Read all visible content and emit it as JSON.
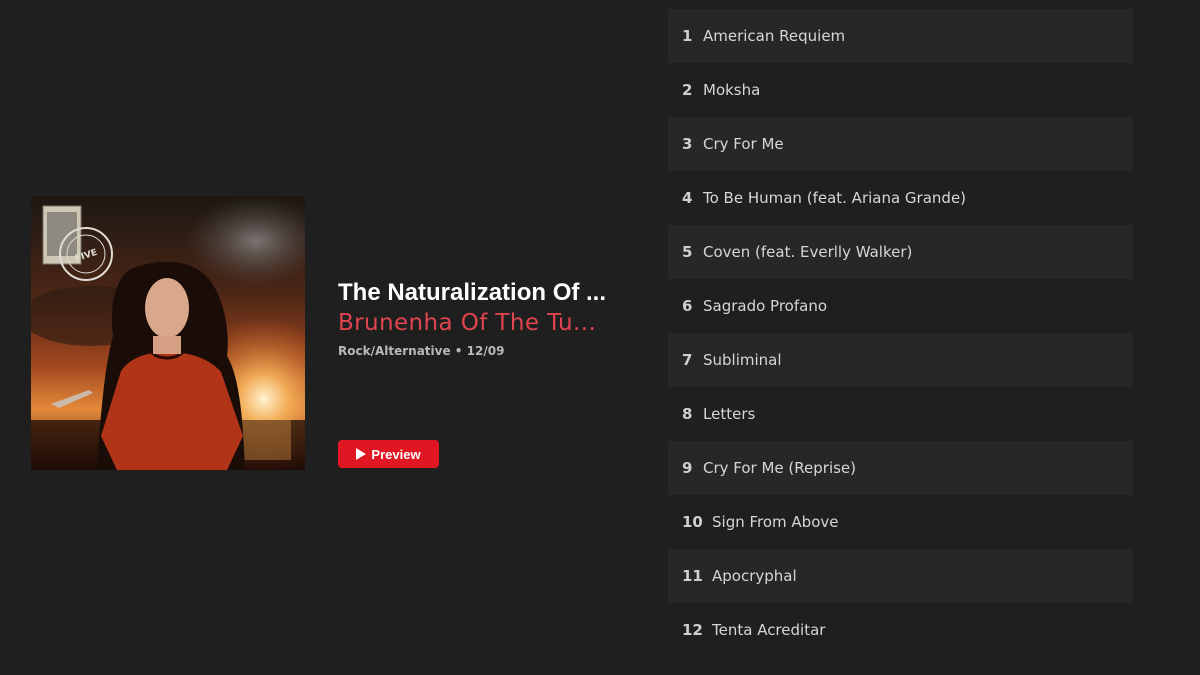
{
  "album": {
    "title": "The Naturalization Of ...",
    "artist": "Brunenha Of The Tu...",
    "meta": "Rock/Alternative • 12/09",
    "cover_icon": "album-cover-art",
    "stamp_text": "FIVE"
  },
  "preview": {
    "label": "Preview",
    "icon": "play-icon",
    "color": "#e01622"
  },
  "colors": {
    "background": "#1f1f20",
    "row_alt": "#272728",
    "artist": "#e0454f"
  },
  "tracks": [
    {
      "num": "1",
      "title": "American Requiem"
    },
    {
      "num": "2",
      "title": "Moksha"
    },
    {
      "num": "3",
      "title": "Cry For Me"
    },
    {
      "num": "4",
      "title": "To Be Human (feat. Ariana Grande)"
    },
    {
      "num": "5",
      "title": "Coven (feat. Everlly Walker)"
    },
    {
      "num": "6",
      "title": "Sagrado Profano"
    },
    {
      "num": "7",
      "title": "Subliminal"
    },
    {
      "num": "8",
      "title": "Letters"
    },
    {
      "num": "9",
      "title": "Cry For Me (Reprise)"
    },
    {
      "num": "10",
      "title": "Sign From Above"
    },
    {
      "num": "11",
      "title": "Apocryphal"
    },
    {
      "num": "12",
      "title": "Tenta Acreditar"
    }
  ]
}
